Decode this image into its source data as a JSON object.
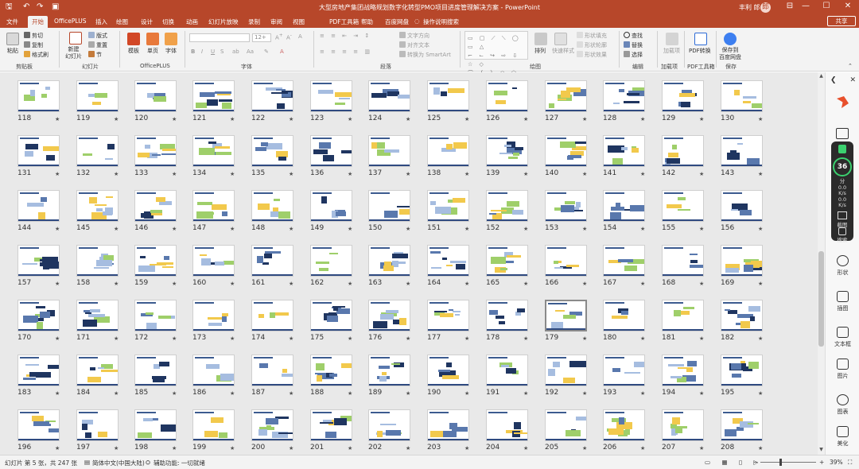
{
  "title_bar": {
    "title": "大型房地产集团战略规划数字化转型PMO项目进度管理解决方案  -  PowerPoint",
    "user": "丰利 郎",
    "avatar_text": "郎",
    "quick_access": [
      "save-icon",
      "undo-icon",
      "redo-icon",
      "slideshow-icon"
    ],
    "window_controls": [
      "—",
      "☐",
      "✕"
    ],
    "ribbon_toggle": "⊟"
  },
  "tabs": [
    "文件",
    "开始",
    "OfficePLUS",
    "插入",
    "绘图",
    "设计",
    "切换",
    "动画",
    "幻灯片放映",
    "录制",
    "审阅",
    "视图",
    "PDF工具箱",
    "帮助",
    "百度网盘",
    "操作说明搜索"
  ],
  "active_tab": "开始",
  "share_label": "共享",
  "ribbon": {
    "clipboard": {
      "paste": "粘贴",
      "cut": "剪切",
      "copy": "复制",
      "format_painter": "格式刷",
      "label": "剪贴板"
    },
    "slides": {
      "new_slide": "新建\n幻灯片",
      "layout": "版式",
      "reset": "重置",
      "section": "节",
      "label": "幻灯片"
    },
    "officeplus": {
      "template": "模板",
      "single_page": "单页",
      "font": "字体",
      "label": "OfficePLUS"
    },
    "font": {
      "font_size": "12+",
      "bold": "B",
      "italic": "I",
      "underline": "U",
      "strike": "S",
      "label": "字体"
    },
    "paragraph": {
      "text_direction": "文字方向",
      "align_text": "对齐文本",
      "smartart": "转换为 SmartArt",
      "label": "段落"
    },
    "drawing": {
      "arrange": "排列",
      "quick_styles": "快速样式",
      "shape_fill": "形状填充",
      "shape_outline": "形状轮廓",
      "shape_effects": "形状效果",
      "label": "绘图"
    },
    "editing": {
      "find": "查找",
      "replace": "替换",
      "select": "选择",
      "label": "编辑"
    },
    "addins": {
      "addins": "加载项",
      "label": "加载项"
    },
    "pdf": {
      "pdf_convert": "PDF转换",
      "label": "PDF工具箱"
    },
    "save": {
      "save_to": "保存到\n百度网盘",
      "label": "保存"
    }
  },
  "slide_sorter": {
    "star_symbol": "★",
    "selected_slide": 179,
    "rows": [
      [
        118,
        119,
        120,
        121,
        122,
        123,
        124,
        125,
        126,
        127,
        128,
        129,
        130
      ],
      [
        131,
        132,
        133,
        134,
        135,
        136,
        137,
        138,
        139,
        140,
        141,
        142,
        143
      ],
      [
        144,
        145,
        146,
        147,
        148,
        149,
        150,
        151,
        152,
        153,
        154,
        155,
        156
      ],
      [
        157,
        158,
        159,
        160,
        161,
        162,
        163,
        164,
        165,
        166,
        167,
        168,
        169
      ],
      [
        170,
        171,
        172,
        173,
        174,
        175,
        176,
        177,
        178,
        179,
        180,
        181,
        182
      ],
      [
        183,
        184,
        185,
        186,
        187,
        188,
        189,
        190,
        191,
        192,
        193,
        194,
        195
      ],
      [
        196,
        197,
        198,
        199,
        200,
        201,
        202,
        203,
        204,
        205,
        206,
        207,
        208
      ]
    ]
  },
  "side_panel": {
    "score": "36",
    "score_unit": "分",
    "stats": [
      "0.0",
      "K/s",
      "0.0",
      "K/s"
    ],
    "capture": "截图",
    "search": "搜索",
    "items": [
      "形状",
      "插图",
      "文本框",
      "图片",
      "图表",
      "美化"
    ]
  },
  "status_bar": {
    "slide_info": "幻灯片 第 5 张，共 247 张",
    "language": "简体中文(中国大陆)",
    "accessibility": "辅助功能: 一切就绪",
    "zoom": "39%",
    "zoom_minus": "−",
    "zoom_plus": "+"
  }
}
